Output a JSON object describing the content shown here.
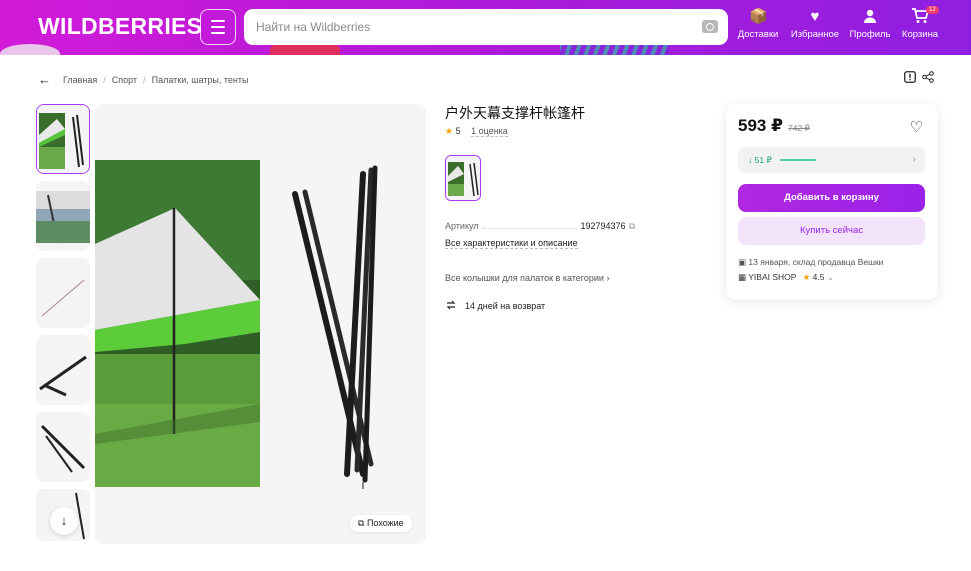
{
  "header": {
    "logo": "WILDBERRIES",
    "search_placeholder": "Найти на Wildberries",
    "nav": [
      {
        "label": "Доставки",
        "icon": "delivery-icon"
      },
      {
        "label": "Избранное",
        "icon": "heart-icon"
      },
      {
        "label": "Профиль",
        "icon": "profile-icon"
      },
      {
        "label": "Корзина",
        "icon": "cart-icon"
      }
    ],
    "cart_badge": "12"
  },
  "breadcrumb": [
    "Главная",
    "Спорт",
    "Палатки, шатры, тенты"
  ],
  "product": {
    "title": "户外天幕支撑杆帐篷杆",
    "rating": "5",
    "reviews": "1 оценка",
    "article_label": "Артикул",
    "article_value": "192794376",
    "all_characteristics": "Все характеристики и описание",
    "category_link": "Все колышки для палаток в категории",
    "return_policy": "14 дней на возврат",
    "similar_label": "Похожие"
  },
  "price_card": {
    "price": "593 ₽",
    "old_price": "742 ₽",
    "discount": "↓ 51 ₽",
    "add_to_cart": "Добавить в корзину",
    "buy_now": "Купить сейчас",
    "delivery": "13 января, склад продавца Вешки",
    "shop_name": "YIBAI SHOP",
    "shop_rating": "4.5"
  },
  "colors": {
    "brand": "#a73afd",
    "header_gradient_start": "#d11bd8",
    "header_gradient_end": "#8f1fe0",
    "discount_green": "#13a06a"
  }
}
